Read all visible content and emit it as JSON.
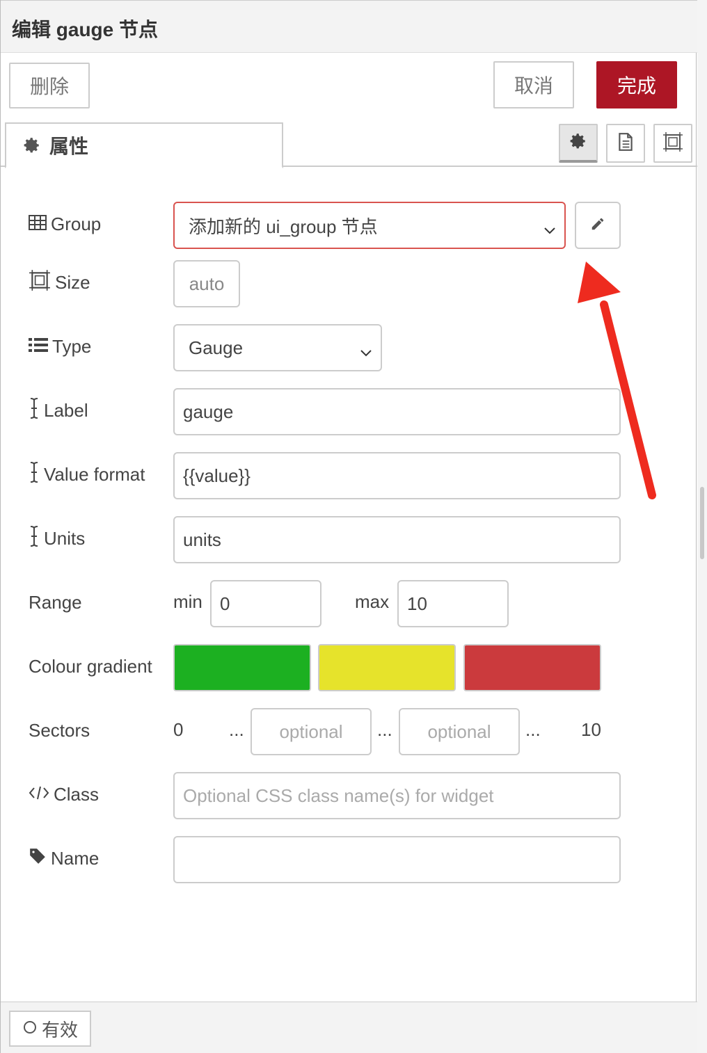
{
  "title": "编辑 gauge 节点",
  "buttons": {
    "delete": "删除",
    "cancel": "取消",
    "done": "完成"
  },
  "tab": {
    "label": "属性",
    "icon": "gear-icon"
  },
  "side_icons": [
    "gear-icon",
    "document-icon",
    "frame-icon"
  ],
  "colors": {
    "primary": "#ad1625",
    "green": "#1cb021",
    "yellow": "#e6e32b",
    "red": "#cb3a3d",
    "arrow": "#ee2b1f",
    "error_border": "#d9534f"
  },
  "fields": {
    "group": {
      "label": "Group",
      "value": "添加新的 ui_group 节点"
    },
    "size": {
      "label": "Size",
      "value": "auto"
    },
    "type": {
      "label": "Type",
      "value": "Gauge"
    },
    "label": {
      "label": "Label",
      "value": "gauge"
    },
    "value_format": {
      "label": "Value format",
      "value": "{{value}}"
    },
    "units": {
      "label": "Units",
      "value": "units"
    },
    "range": {
      "label": "Range",
      "min_label": "min",
      "min": "0",
      "max_label": "max",
      "max": "10"
    },
    "colour_gradient": {
      "label": "Colour gradient"
    },
    "sectors": {
      "label": "Sectors",
      "start": "0",
      "sep": "...",
      "placeholder1": "optional",
      "placeholder2": "optional",
      "end": "10"
    },
    "class": {
      "label": "Class",
      "placeholder": "Optional CSS class name(s) for widget"
    },
    "name": {
      "label": "Name",
      "value": ""
    }
  },
  "footer": {
    "enabled_label": "有效"
  }
}
